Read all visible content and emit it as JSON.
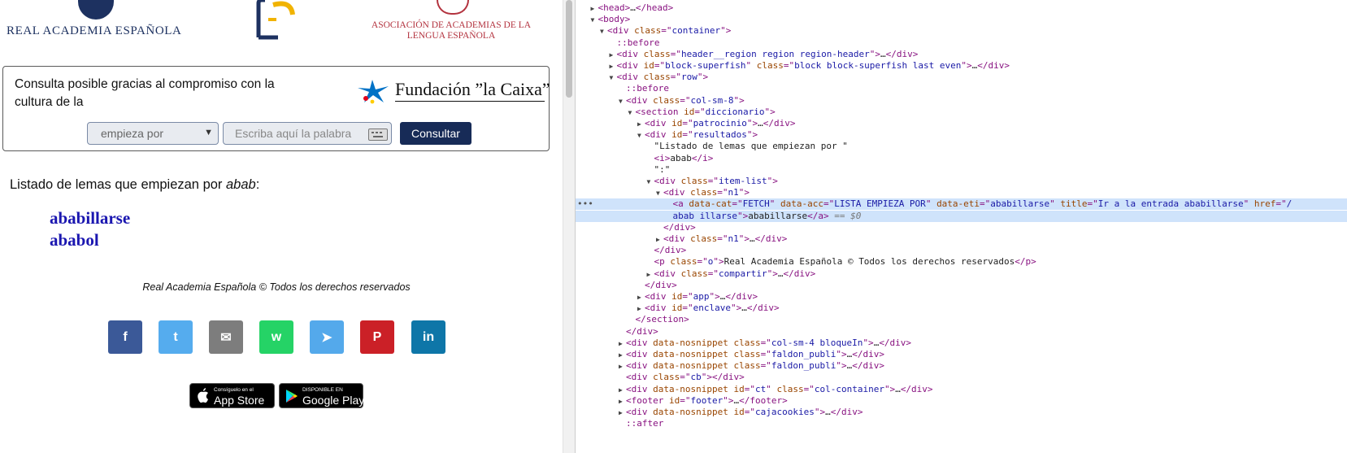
{
  "header": {
    "rae_logo_text": "REAL ACADEMIA ESPAÑOLA",
    "asale_line1": "ASOCIACIÓN DE ACADEMIAS DE LA",
    "asale_line2": "LENGUA ESPAÑOLA"
  },
  "sponsor": {
    "text": "Consulta posible gracias al compromiso con la cultura de la",
    "brand": "Fundación ”la Caixa”"
  },
  "search": {
    "mode": "empieza por",
    "placeholder": "Escriba aquí la palabra",
    "submit_label": "Consultar"
  },
  "results": {
    "heading_prefix": "Listado de lemas que empiezan por ",
    "query": "abab",
    "heading_suffix": ":",
    "items": [
      "ababillarse",
      "ababol"
    ]
  },
  "footer": {
    "copyright": "Real Academia Española © Todos los derechos reservados"
  },
  "share": [
    {
      "name": "facebook",
      "glyph": "f",
      "color": "#3b5998"
    },
    {
      "name": "twitter",
      "glyph": "t",
      "color": "#55acee"
    },
    {
      "name": "email",
      "glyph": "✉",
      "color": "#7d7d7d"
    },
    {
      "name": "whatsapp",
      "glyph": "w",
      "color": "#25d366"
    },
    {
      "name": "telegram",
      "glyph": "➤",
      "color": "#54a9eb"
    },
    {
      "name": "pinterest",
      "glyph": "P",
      "color": "#cb2027"
    },
    {
      "name": "linkedin",
      "glyph": "in",
      "color": "#0e76a8"
    }
  ],
  "stores": {
    "appstore_small": "Consíguelo en el",
    "appstore_big": "App Store",
    "googleplay_small": "DISPONIBLE EN",
    "googleplay_big": "Google Play"
  },
  "devtools": {
    "lines": [
      {
        "indent": 1,
        "tri": "▶",
        "parts": [
          [
            "tag",
            "<head>"
          ],
          [
            "txt",
            "…"
          ],
          [
            "tag",
            "</head>"
          ]
        ]
      },
      {
        "indent": 1,
        "tri": "▼",
        "parts": [
          [
            "tag",
            "<body>"
          ]
        ]
      },
      {
        "indent": 2,
        "tri": "▼",
        "parts": [
          [
            "tag",
            "<div "
          ],
          [
            "attr",
            "class"
          ],
          [
            "tag",
            "=\""
          ],
          [
            "val",
            "container"
          ],
          [
            "tag",
            "\">"
          ]
        ]
      },
      {
        "indent": 3,
        "tri": "",
        "parts": [
          [
            "pseudo",
            "::before"
          ]
        ]
      },
      {
        "indent": 3,
        "tri": "▶",
        "parts": [
          [
            "tag",
            "<div "
          ],
          [
            "attr",
            "class"
          ],
          [
            "tag",
            "=\""
          ],
          [
            "val",
            "header__region region region-header"
          ],
          [
            "tag",
            "\">"
          ],
          [
            "txt",
            "…"
          ],
          [
            "tag",
            "</div>"
          ]
        ]
      },
      {
        "indent": 3,
        "tri": "▶",
        "parts": [
          [
            "tag",
            "<div "
          ],
          [
            "attr",
            "id"
          ],
          [
            "tag",
            "=\""
          ],
          [
            "val",
            "block-superfish"
          ],
          [
            "tag",
            "\" "
          ],
          [
            "attr",
            "class"
          ],
          [
            "tag",
            "=\""
          ],
          [
            "val",
            "block block-superfish last even"
          ],
          [
            "tag",
            "\">"
          ],
          [
            "txt",
            "…"
          ],
          [
            "tag",
            "</div>"
          ]
        ]
      },
      {
        "indent": 3,
        "tri": "▼",
        "parts": [
          [
            "tag",
            "<div "
          ],
          [
            "attr",
            "class"
          ],
          [
            "tag",
            "=\""
          ],
          [
            "val",
            "row"
          ],
          [
            "tag",
            "\">"
          ]
        ]
      },
      {
        "indent": 4,
        "tri": "",
        "parts": [
          [
            "pseudo",
            "::before"
          ]
        ]
      },
      {
        "indent": 4,
        "tri": "▼",
        "parts": [
          [
            "tag",
            "<div "
          ],
          [
            "attr",
            "class"
          ],
          [
            "tag",
            "=\""
          ],
          [
            "val",
            "col-sm-8"
          ],
          [
            "tag",
            "\">"
          ]
        ]
      },
      {
        "indent": 5,
        "tri": "▼",
        "parts": [
          [
            "tag",
            "<section "
          ],
          [
            "attr",
            "id"
          ],
          [
            "tag",
            "=\""
          ],
          [
            "val",
            "diccionario"
          ],
          [
            "tag",
            "\">"
          ]
        ]
      },
      {
        "indent": 6,
        "tri": "▶",
        "parts": [
          [
            "tag",
            "<div "
          ],
          [
            "attr",
            "id"
          ],
          [
            "tag",
            "=\""
          ],
          [
            "val",
            "patrocinio"
          ],
          [
            "tag",
            "\">"
          ],
          [
            "txt",
            "…"
          ],
          [
            "tag",
            "</div>"
          ]
        ]
      },
      {
        "indent": 6,
        "tri": "▼",
        "parts": [
          [
            "tag",
            "<div "
          ],
          [
            "attr",
            "id"
          ],
          [
            "tag",
            "=\""
          ],
          [
            "val",
            "resultados"
          ],
          [
            "tag",
            "\">"
          ]
        ]
      },
      {
        "indent": 7,
        "tri": "",
        "parts": [
          [
            "txt",
            "\"Listado de lemas que empiezan por \""
          ]
        ]
      },
      {
        "indent": 7,
        "tri": "",
        "parts": [
          [
            "tag",
            "<i>"
          ],
          [
            "txt",
            "abab"
          ],
          [
            "tag",
            "</i>"
          ]
        ]
      },
      {
        "indent": 7,
        "tri": "",
        "parts": [
          [
            "txt",
            "\":\""
          ]
        ]
      },
      {
        "indent": 7,
        "tri": "▼",
        "parts": [
          [
            "tag",
            "<div "
          ],
          [
            "attr",
            "class"
          ],
          [
            "tag",
            "=\""
          ],
          [
            "val",
            "item-list"
          ],
          [
            "tag",
            "\">"
          ]
        ]
      },
      {
        "indent": 8,
        "tri": "▼",
        "parts": [
          [
            "tag",
            "<div "
          ],
          [
            "attr",
            "class"
          ],
          [
            "tag",
            "=\""
          ],
          [
            "val",
            "n1"
          ],
          [
            "tag",
            "\">"
          ]
        ]
      },
      {
        "indent": 9,
        "tri": "",
        "sel": true,
        "parts": [
          [
            "tag",
            "<a "
          ],
          [
            "attr",
            "data-cat"
          ],
          [
            "tag",
            "=\""
          ],
          [
            "val",
            "FETCH"
          ],
          [
            "tag",
            "\" "
          ],
          [
            "attr",
            "data-acc"
          ],
          [
            "tag",
            "=\""
          ],
          [
            "val",
            "LISTA EMPIEZA POR"
          ],
          [
            "tag",
            "\" "
          ],
          [
            "attr",
            "data-eti"
          ],
          [
            "tag",
            "=\""
          ],
          [
            "val",
            "ababillarse"
          ],
          [
            "tag",
            "\" "
          ],
          [
            "attr",
            "title"
          ],
          [
            "tag",
            "=\""
          ],
          [
            "val",
            "Ir a la entrada ababillarse"
          ],
          [
            "tag",
            "\" "
          ],
          [
            "attr",
            "href"
          ],
          [
            "tag",
            "=\""
          ],
          [
            "val",
            "/"
          ]
        ]
      },
      {
        "indent": 9,
        "tri": "",
        "sel": true,
        "parts": [
          [
            "val",
            "abab illarse"
          ],
          [
            "tag",
            "\">"
          ],
          [
            "txt",
            "ababillarse"
          ],
          [
            "tag",
            "</a>"
          ],
          [
            "eq",
            " == $0"
          ]
        ]
      },
      {
        "indent": 8,
        "tri": "",
        "parts": [
          [
            "tag",
            "</div>"
          ]
        ]
      },
      {
        "indent": 8,
        "tri": "▶",
        "parts": [
          [
            "tag",
            "<div "
          ],
          [
            "attr",
            "class"
          ],
          [
            "tag",
            "=\""
          ],
          [
            "val",
            "n1"
          ],
          [
            "tag",
            "\">"
          ],
          [
            "txt",
            "…"
          ],
          [
            "tag",
            "</div>"
          ]
        ]
      },
      {
        "indent": 7,
        "tri": "",
        "parts": [
          [
            "tag",
            "</div>"
          ]
        ]
      },
      {
        "indent": 7,
        "tri": "",
        "parts": [
          [
            "tag",
            "<p "
          ],
          [
            "attr",
            "class"
          ],
          [
            "tag",
            "=\""
          ],
          [
            "val",
            "o"
          ],
          [
            "tag",
            "\">"
          ],
          [
            "txt",
            "Real Academia Española © Todos los derechos reservados"
          ],
          [
            "tag",
            "</p>"
          ]
        ]
      },
      {
        "indent": 7,
        "tri": "▶",
        "parts": [
          [
            "tag",
            "<div "
          ],
          [
            "attr",
            "class"
          ],
          [
            "tag",
            "=\""
          ],
          [
            "val",
            "compartir"
          ],
          [
            "tag",
            "\">"
          ],
          [
            "txt",
            "…"
          ],
          [
            "tag",
            "</div>"
          ]
        ]
      },
      {
        "indent": 6,
        "tri": "",
        "parts": [
          [
            "tag",
            "</div>"
          ]
        ]
      },
      {
        "indent": 6,
        "tri": "▶",
        "parts": [
          [
            "tag",
            "<div "
          ],
          [
            "attr",
            "id"
          ],
          [
            "tag",
            "=\""
          ],
          [
            "val",
            "app"
          ],
          [
            "tag",
            "\">"
          ],
          [
            "txt",
            "…"
          ],
          [
            "tag",
            "</div>"
          ]
        ]
      },
      {
        "indent": 6,
        "tri": "▶",
        "parts": [
          [
            "tag",
            "<div "
          ],
          [
            "attr",
            "id"
          ],
          [
            "tag",
            "=\""
          ],
          [
            "val",
            "enclave"
          ],
          [
            "tag",
            "\">"
          ],
          [
            "txt",
            "…"
          ],
          [
            "tag",
            "</div>"
          ]
        ]
      },
      {
        "indent": 5,
        "tri": "",
        "parts": [
          [
            "tag",
            "</section>"
          ]
        ]
      },
      {
        "indent": 4,
        "tri": "",
        "parts": [
          [
            "tag",
            "</div>"
          ]
        ]
      },
      {
        "indent": 4,
        "tri": "▶",
        "parts": [
          [
            "tag",
            "<div "
          ],
          [
            "attr",
            "data-nosnippet"
          ],
          [
            "tag",
            " "
          ],
          [
            "attr",
            "class"
          ],
          [
            "tag",
            "=\""
          ],
          [
            "val",
            "col-sm-4 bloqueIn"
          ],
          [
            "tag",
            "\">"
          ],
          [
            "txt",
            "…"
          ],
          [
            "tag",
            "</div>"
          ]
        ]
      },
      {
        "indent": 4,
        "tri": "▶",
        "parts": [
          [
            "tag",
            "<div "
          ],
          [
            "attr",
            "data-nosnippet"
          ],
          [
            "tag",
            " "
          ],
          [
            "attr",
            "class"
          ],
          [
            "tag",
            "=\""
          ],
          [
            "val",
            "faldon_publi"
          ],
          [
            "tag",
            "\">"
          ],
          [
            "txt",
            "…"
          ],
          [
            "tag",
            "</div>"
          ]
        ]
      },
      {
        "indent": 4,
        "tri": "▶",
        "parts": [
          [
            "tag",
            "<div "
          ],
          [
            "attr",
            "data-nosnippet"
          ],
          [
            "tag",
            " "
          ],
          [
            "attr",
            "class"
          ],
          [
            "tag",
            "=\""
          ],
          [
            "val",
            "faldon_publi"
          ],
          [
            "tag",
            "\">"
          ],
          [
            "txt",
            "…"
          ],
          [
            "tag",
            "</div>"
          ]
        ]
      },
      {
        "indent": 4,
        "tri": "",
        "parts": [
          [
            "tag",
            "<div "
          ],
          [
            "attr",
            "class"
          ],
          [
            "tag",
            "=\""
          ],
          [
            "val",
            "cb"
          ],
          [
            "tag",
            "\">"
          ],
          [
            "tag",
            "</div>"
          ]
        ]
      },
      {
        "indent": 4,
        "tri": "▶",
        "parts": [
          [
            "tag",
            "<div "
          ],
          [
            "attr",
            "data-nosnippet"
          ],
          [
            "tag",
            " "
          ],
          [
            "attr",
            "id"
          ],
          [
            "tag",
            "=\""
          ],
          [
            "val",
            "ct"
          ],
          [
            "tag",
            "\" "
          ],
          [
            "attr",
            "class"
          ],
          [
            "tag",
            "=\""
          ],
          [
            "val",
            "col-container"
          ],
          [
            "tag",
            "\">"
          ],
          [
            "txt",
            "…"
          ],
          [
            "tag",
            "</div>"
          ]
        ]
      },
      {
        "indent": 4,
        "tri": "▶",
        "parts": [
          [
            "tag",
            "<footer "
          ],
          [
            "attr",
            "id"
          ],
          [
            "tag",
            "=\""
          ],
          [
            "val",
            "footer"
          ],
          [
            "tag",
            "\">"
          ],
          [
            "txt",
            "…"
          ],
          [
            "tag",
            "</footer>"
          ]
        ]
      },
      {
        "indent": 4,
        "tri": "▶",
        "parts": [
          [
            "tag",
            "<div "
          ],
          [
            "attr",
            "data-nosnippet"
          ],
          [
            "tag",
            " "
          ],
          [
            "attr",
            "id"
          ],
          [
            "tag",
            "=\""
          ],
          [
            "val",
            "cajacookies"
          ],
          [
            "tag",
            "\">"
          ],
          [
            "txt",
            "…"
          ],
          [
            "tag",
            "</div>"
          ]
        ]
      },
      {
        "indent": 4,
        "tri": "",
        "parts": [
          [
            "pseudo",
            "::after"
          ]
        ]
      }
    ]
  }
}
